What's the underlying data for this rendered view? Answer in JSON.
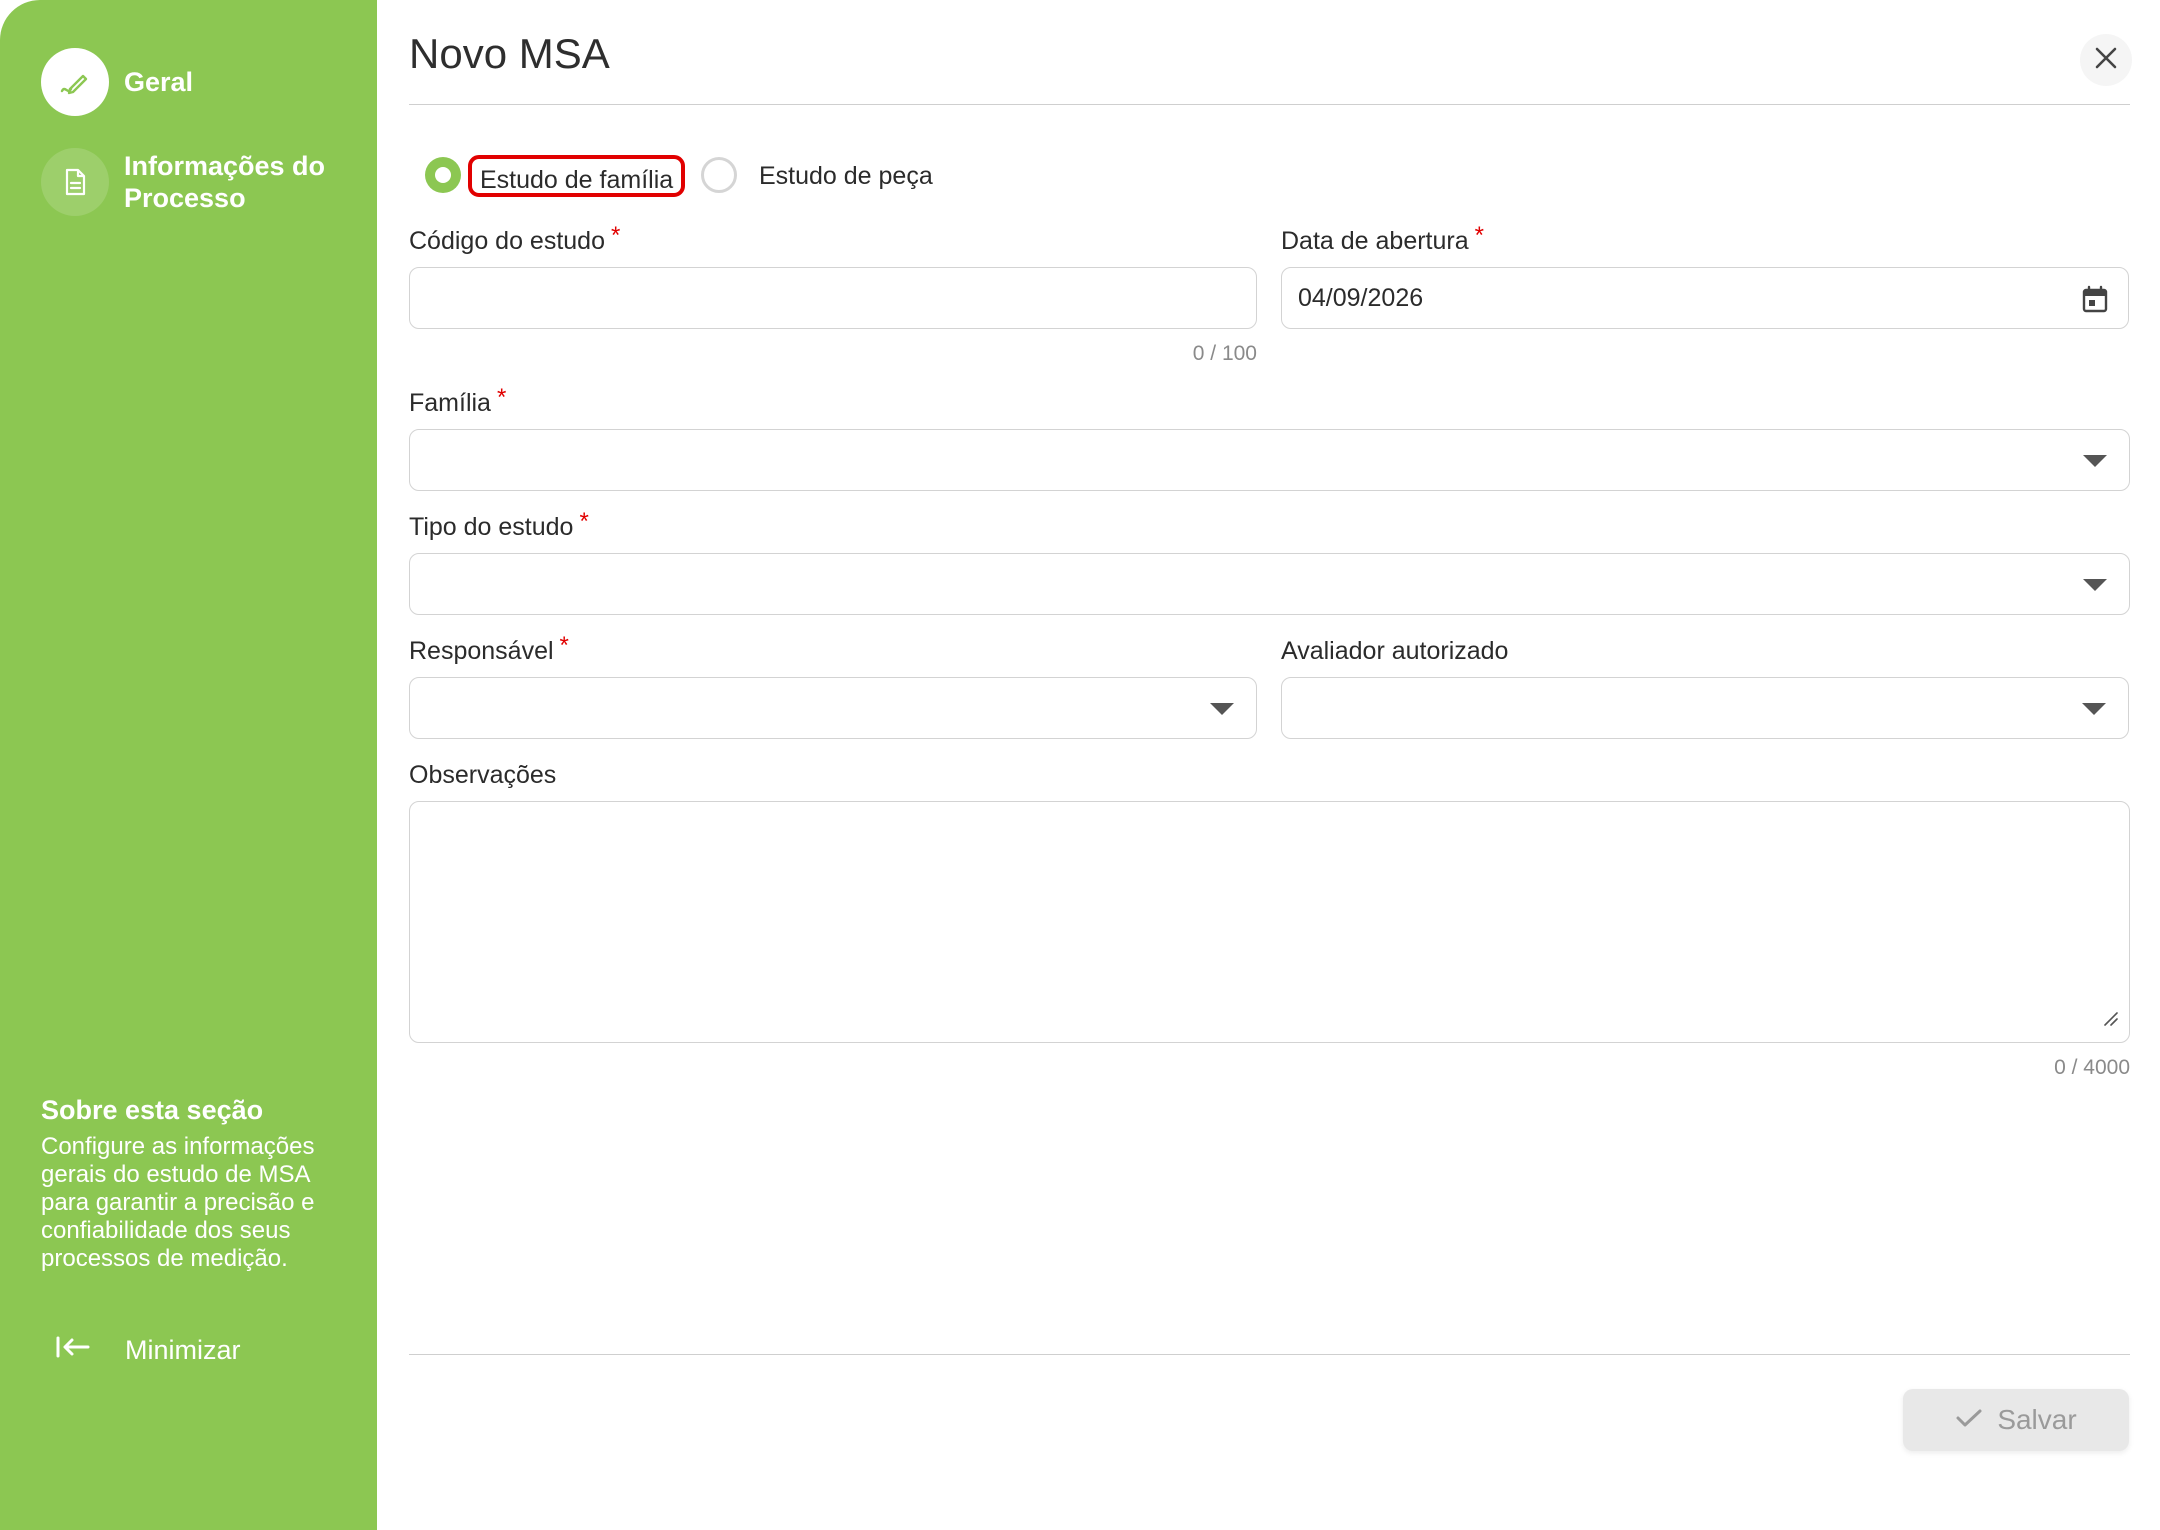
{
  "sidebar": {
    "items": [
      {
        "label": "Geral",
        "icon": "pencil-icon",
        "active": true
      },
      {
        "label": "Informações do Processo",
        "icon": "document-icon",
        "active": false
      }
    ],
    "about_title": "Sobre esta seção",
    "about_text": "Configure as informações gerais do estudo de MSA para garantir a precisão e confiabilidade dos seus processos de medição.",
    "minimize_label": "Minimizar",
    "background_color": "#8cc752"
  },
  "dialog": {
    "title": "Novo MSA",
    "study_type_options": [
      {
        "label": "Estudo de família",
        "checked": true
      },
      {
        "label": "Estudo de peça",
        "checked": false
      }
    ],
    "fields": {
      "codigo": {
        "label": "Código do estudo",
        "required": "*",
        "value": "",
        "counter": "0 / 100"
      },
      "data_abertura": {
        "label": "Data de abertura",
        "required": "*",
        "value": "04/09/2026"
      },
      "familia": {
        "label": "Família",
        "required": "*",
        "value": ""
      },
      "tipo_estudo": {
        "label": "Tipo do estudo",
        "required": "*",
        "value": ""
      },
      "responsavel": {
        "label": "Responsável",
        "required": "*",
        "value": ""
      },
      "avaliador": {
        "label": "Avaliador autorizado",
        "value": ""
      },
      "observacoes": {
        "label": "Observações",
        "value": "",
        "counter": "0 / 4000"
      }
    },
    "save_label": "Salvar",
    "accent_color": "#8cc752",
    "highlight_color": "#e10000"
  }
}
